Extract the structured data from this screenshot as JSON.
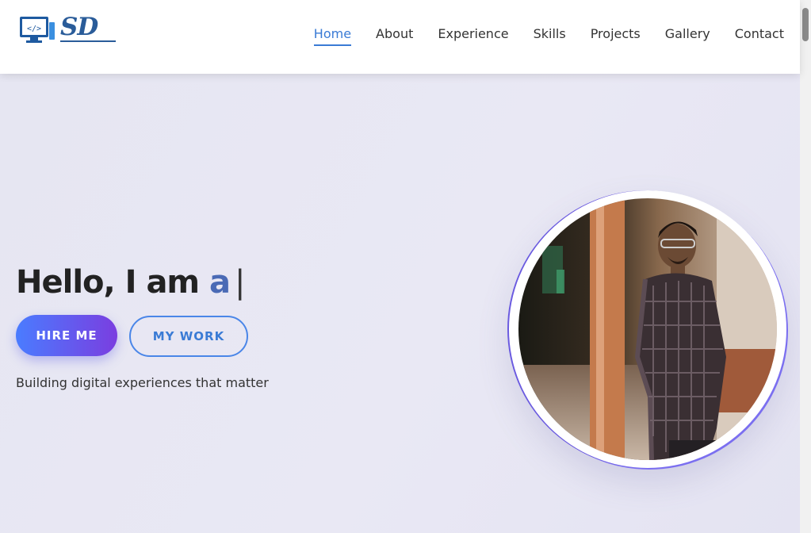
{
  "logo": {
    "text": "SD",
    "icon": "code-monitor-icon"
  },
  "nav": {
    "items": [
      {
        "label": "Home",
        "active": true
      },
      {
        "label": "About",
        "active": false
      },
      {
        "label": "Experience",
        "active": false
      },
      {
        "label": "Skills",
        "active": false
      },
      {
        "label": "Projects",
        "active": false
      },
      {
        "label": "Gallery",
        "active": false
      },
      {
        "label": "Contact",
        "active": false
      }
    ]
  },
  "hero": {
    "title_prefix": "Hello, I am",
    "title_accent": "a",
    "cursor": "|",
    "hire_label": "HIRE ME",
    "work_label": "MY WORK",
    "tagline": "Building digital experiences that matter",
    "profile_photo": "profile-photo"
  },
  "colors": {
    "accent": "#3a7bd5",
    "gradient_start": "#4a7cff",
    "gradient_end": "#7a3ee0",
    "background": "#e8e8f3"
  }
}
